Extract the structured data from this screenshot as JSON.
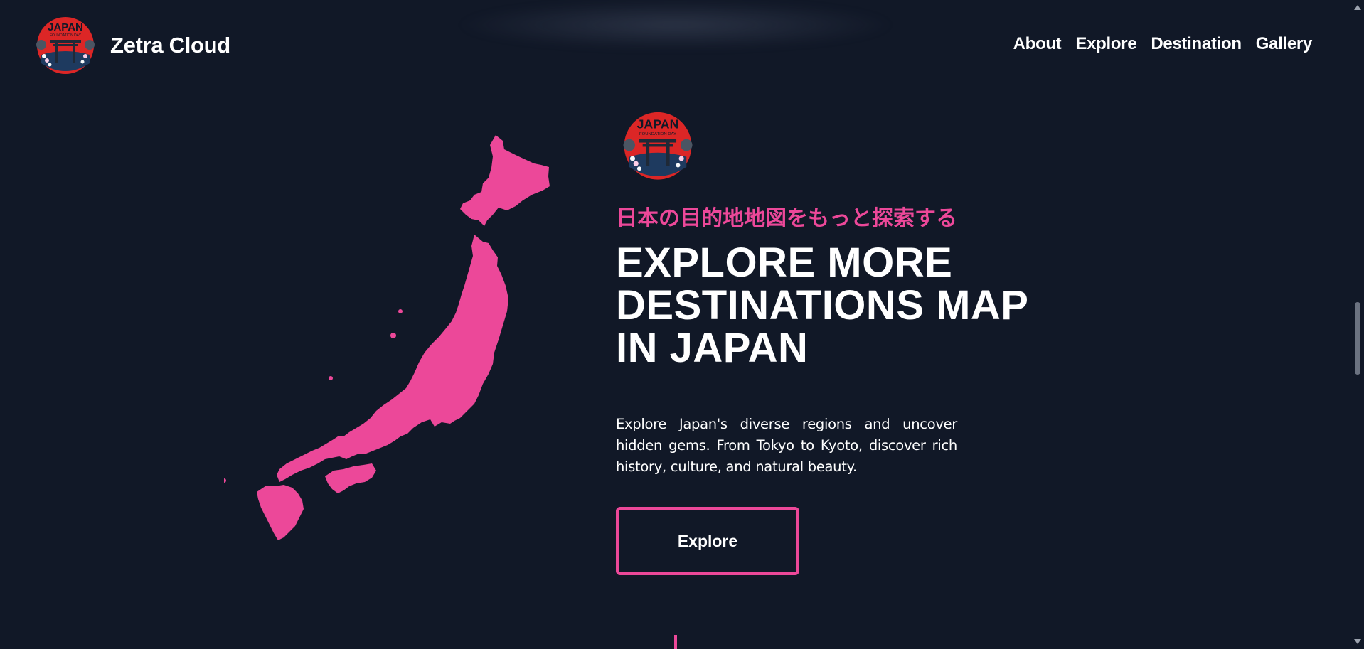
{
  "brand": {
    "name": "Zetra Cloud",
    "logo_text": "JAPAN",
    "logo_subtext": "FOUNDATION DAY"
  },
  "nav": {
    "items": [
      {
        "label": "About"
      },
      {
        "label": "Explore"
      },
      {
        "label": "Destination"
      },
      {
        "label": "Gallery"
      }
    ]
  },
  "hero": {
    "subtitle_jp": "日本の目的地地図をもっと探索する",
    "title_lines": [
      "EXPLORE MORE",
      "DESTINATIONS MAP",
      "IN JAPAN"
    ],
    "description": "Explore Japan's diverse regions and uncover hidden gems. From Tokyo to Kyoto, discover rich history, culture, and natural beauty.",
    "cta_label": "Explore"
  },
  "colors": {
    "background": "#111827",
    "accent": "#ec4899",
    "text": "#ffffff"
  },
  "icons": {
    "map": "japan-map-icon",
    "logo": "japan-torii-logo-icon"
  }
}
